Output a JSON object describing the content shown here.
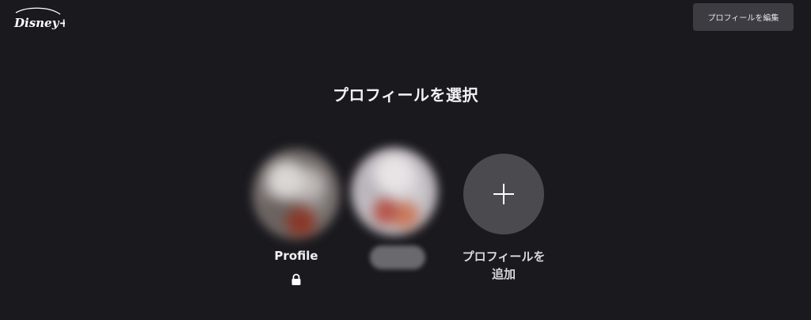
{
  "header": {
    "logo_text": "Disney+",
    "edit_profiles_label": "プロフィールを編集"
  },
  "main": {
    "title": "プロフィールを選択",
    "profiles": [
      {
        "name": "Profile",
        "locked": true,
        "icon": "lock-icon"
      },
      {
        "name": "",
        "locked": false
      }
    ],
    "add_profile": {
      "label_line1": "プロフィールを",
      "label_line2": "追加",
      "icon": "plus-icon"
    }
  },
  "colors": {
    "background": "#1a191e",
    "edit_button_bg": "#3d3c42",
    "add_circle_bg": "#4a4a4f",
    "text": "#f2f2f4"
  }
}
